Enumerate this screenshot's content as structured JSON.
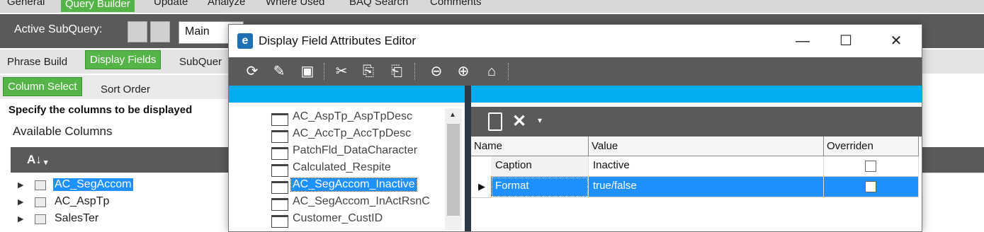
{
  "menu": {
    "items": [
      "General",
      "Query Builder",
      "Update",
      "Analyze",
      "Where Used",
      "BAQ Search",
      "Comments"
    ],
    "active_index": 1
  },
  "subquery": {
    "label": "Active SubQuery:",
    "value": "Main"
  },
  "tabs_row1": {
    "items": [
      "Phrase Build",
      "Display Fields",
      "SubQuer"
    ],
    "active_index": 1
  },
  "tabs_row2": {
    "items": [
      "Column Select",
      "Sort Order"
    ],
    "active_index": 0
  },
  "main": {
    "instruction": "Specify the columns to be displayed",
    "available_columns_label": "Available Columns",
    "tree_items": [
      {
        "label": "AC_SegAccom",
        "selected": true
      },
      {
        "label": "AC_AspTp",
        "selected": false
      },
      {
        "label": "SalesTer",
        "selected": false
      }
    ]
  },
  "dialog": {
    "title": "Display Field Attributes Editor",
    "field_list": [
      {
        "label": "AC_AspTp_AspTpDesc",
        "selected": false
      },
      {
        "label": "AC_AccTp_AccTpDesc",
        "selected": false
      },
      {
        "label": "PatchFld_DataCharacter",
        "selected": false
      },
      {
        "label": "Calculated_Respite",
        "selected": false
      },
      {
        "label": "AC_SegAccom_Inactive",
        "selected": true
      },
      {
        "label": "AC_SegAccom_InActRsnC",
        "selected": false
      },
      {
        "label": "Customer_CustID",
        "selected": false
      }
    ],
    "grid": {
      "columns": [
        "Name",
        "Value",
        "Overriden"
      ],
      "rows": [
        {
          "name": "Caption",
          "value": "Inactive",
          "overriden": false,
          "selected": false
        },
        {
          "name": "Format",
          "value": "true/false",
          "overriden": false,
          "selected": true
        }
      ]
    }
  },
  "icons": {
    "toolbar": [
      "refresh-icon",
      "clear-icon",
      "save-icon",
      "cut-icon",
      "copy-icon",
      "paste-icon",
      "back-icon",
      "forward-icon",
      "home-icon"
    ],
    "grid_toolbar": [
      "new-icon",
      "delete-icon",
      "dropdown-icon"
    ]
  },
  "colors": {
    "accent_green": "#55b447",
    "selection_blue": "#1e90ff",
    "banner_blue": "#00aeef",
    "toolbar_gray": "#5a5a5a"
  }
}
